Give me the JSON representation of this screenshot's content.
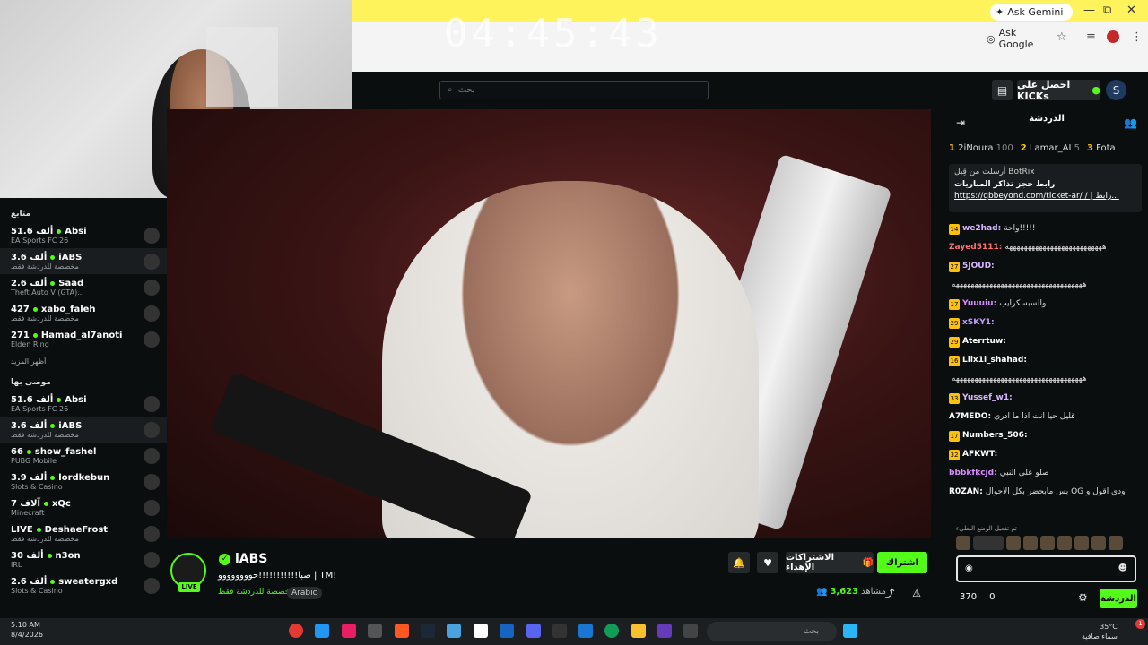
{
  "overlay": {
    "timer": "04:45:43"
  },
  "browser": {
    "ask_gemini": "Ask Gemini",
    "ask_google": "Ask Google",
    "window_min": "—",
    "window_max": "⧉",
    "window_close": "✕"
  },
  "header": {
    "search_placeholder": "بحث",
    "kicks_label": "احصل على KICKs"
  },
  "sidebar": {
    "section_following": "متابع",
    "following": [
      {
        "viewers": "51.6 ألف",
        "name": "Absi",
        "category": "EA Sports FC 26"
      },
      {
        "viewers": "3.6 ألف",
        "name": "iABS",
        "category": "مخصصة للدردشة فقط"
      },
      {
        "viewers": "2.6 ألف",
        "name": "Saad",
        "category": "Theft Auto V (GTA)..."
      },
      {
        "viewers": "427",
        "name": "xabo_faleh",
        "category": "مخصصة للدردشة فقط"
      },
      {
        "viewers": "271",
        "name": "Hamad_al7anoti",
        "category": "Elden Ring"
      }
    ],
    "show_more": "أظهر المزيد",
    "section_recommended": "موصى بها",
    "recommended": [
      {
        "viewers": "51.6 ألف",
        "name": "Absi",
        "category": "EA Sports FC 26"
      },
      {
        "viewers": "3.6 ألف",
        "name": "iABS",
        "category": "مخصصة للدردشة فقط"
      },
      {
        "viewers": "66",
        "name": "show_fashel",
        "category": "PUBG Mobile"
      },
      {
        "viewers": "3.9 ألف",
        "name": "lordkebun",
        "category": "Slots & Casino"
      },
      {
        "viewers": "7 آلاف",
        "name": "xQc",
        "category": "Minecraft"
      },
      {
        "viewers": "LIVE",
        "name": "DeshaeFrost",
        "category": "مخصصة للدردشة فقط"
      },
      {
        "viewers": "30 ألف",
        "name": "n3on",
        "category": "IRL"
      },
      {
        "viewers": "2.6 ألف",
        "name": "sweatergxd",
        "category": "Slots & Casino"
      }
    ]
  },
  "stream": {
    "name": "iABS",
    "live": "LIVE",
    "title": "صبا!!!!!!!!!!!حوووووووو | TM!",
    "category": "مخصصة للدردشة فقط",
    "tag": "Arabic",
    "subscribe": "اشتراك",
    "gift": "الاشتراكات الإهداء",
    "viewers_label": "مشاهد",
    "viewers": "3,623"
  },
  "chat": {
    "title": "الدردشة",
    "leaderboard": [
      {
        "rank": "1",
        "name": "2iNoura",
        "score": "100"
      },
      {
        "rank": "2",
        "name": "Lamar_AI",
        "score": "5"
      },
      {
        "rank": "3",
        "name": "Fota",
        "score": ""
      }
    ],
    "pinned_by": "أرسلت من قِبل BotRix",
    "pinned_title": "رابط حجز تذاكر المباريات",
    "pinned_link": "https://qbbeyond.com/ticket-ar/ / | رابط...",
    "messages": [
      {
        "badge": "14",
        "user": "we2had:",
        "color": "#d9b6ff",
        "text": "واحة!!!!!"
      },
      {
        "badge": "",
        "user": "Zayed5111:",
        "color": "#ff6f6f",
        "text": "ههههههههههههههههههههههههههه"
      },
      {
        "badge": "27",
        "user": "5JOUD:",
        "color": "#d9b6ff",
        "text": ""
      },
      {
        "badge": "",
        "user": "",
        "color": "#ddd",
        "text": "هههههههههههههههههههههههههههههههههههه"
      },
      {
        "badge": "17",
        "user": "Yuuuiu:",
        "color": "#d98bff",
        "text": "والسبسكرايب"
      },
      {
        "badge": "29",
        "user": "xSKY1:",
        "color": "#c2a0ff",
        "text": ""
      },
      {
        "badge": "29",
        "user": "Aterrtuw:",
        "color": "#fff",
        "text": ""
      },
      {
        "badge": "16",
        "user": "Lilx1l_shahad:",
        "color": "#fff",
        "text": ""
      },
      {
        "badge": "",
        "user": "",
        "color": "#ddd",
        "text": "هههههههههههههههههههههههههههههههههههه"
      },
      {
        "badge": "33",
        "user": "Yussef_w1:",
        "color": "#d9b6ff",
        "text": ""
      },
      {
        "badge": "",
        "user": "A7MEDO:",
        "color": "#fff",
        "text": "قليل حيا انت اذا ما ادري"
      },
      {
        "badge": "17",
        "user": "Numbers_506:",
        "color": "#fff",
        "text": ""
      },
      {
        "badge": "32",
        "user": "AFKWT:",
        "color": "#fff",
        "text": ""
      },
      {
        "badge": "",
        "user": "bbbkfkcjd:",
        "color": "#d98bff",
        "text": "صلو على النبي"
      },
      {
        "badge": "",
        "user": "R0ZAN:",
        "color": "#fff",
        "text": "بس مابحضر بكل الاحوال OG ودي اقول و"
      }
    ],
    "slow_mode": "تم تفعيل الوضع البطيء",
    "send": "الدردشة",
    "count1": "370",
    "count2": "0"
  },
  "taskbar": {
    "time": "5:10 AM",
    "date": "8/4/2026",
    "search": "بحث",
    "temp": "35°C",
    "weather": "سماء صافية",
    "notif": "1"
  }
}
